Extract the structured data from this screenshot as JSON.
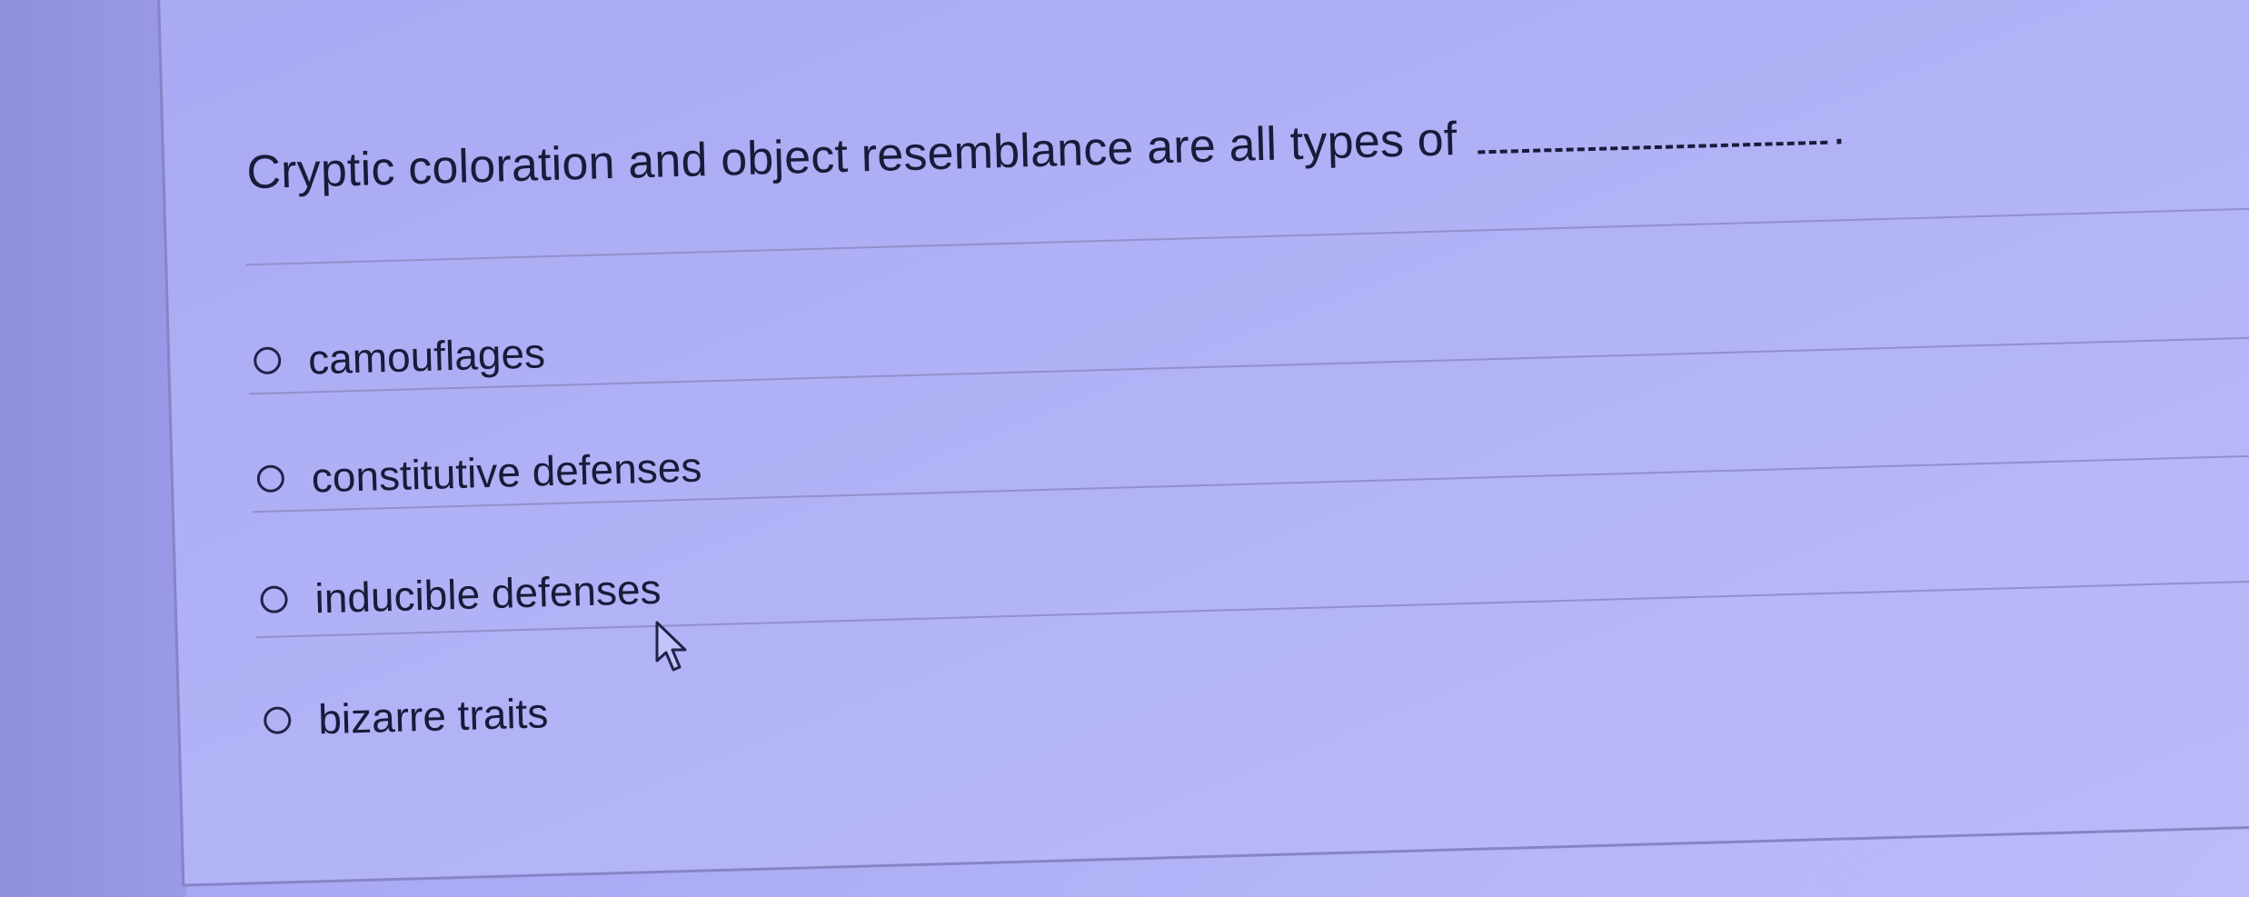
{
  "question": {
    "text": "Cryptic coloration and object resemblance are all types of",
    "terminator": "."
  },
  "options": [
    {
      "label": "camouflages",
      "selected": false
    },
    {
      "label": "constitutive defenses",
      "selected": false
    },
    {
      "label": "inducible defenses",
      "selected": false
    },
    {
      "label": "bizarre traits",
      "selected": false
    }
  ],
  "colors": {
    "background": "#b2b2f7",
    "text": "#1a1a3a",
    "divider": "#9090cc"
  },
  "icons": {
    "cursor": "arrow-cursor-icon",
    "radio": "radio-button-icon"
  }
}
